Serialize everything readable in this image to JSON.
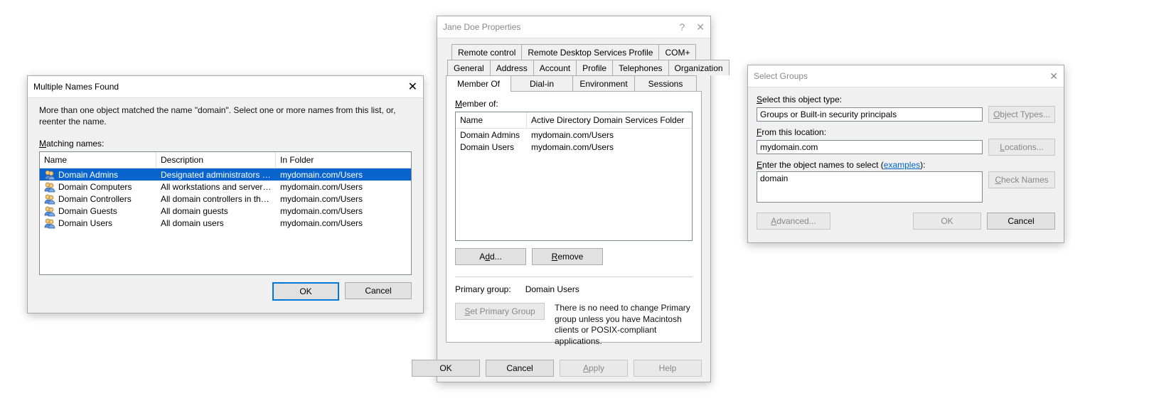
{
  "dlg1": {
    "title": "Multiple Names Found",
    "instruction": "More than one object matched the name \"domain\". Select one or more names from this list, or, reenter the name.",
    "matching_label": "Matching names:",
    "headers": {
      "name": "Name",
      "desc": "Description",
      "folder": "In Folder"
    },
    "rows": [
      {
        "name": "Domain Admins",
        "desc": "Designated administrators of th...",
        "folder": "mydomain.com/Users",
        "selected": true
      },
      {
        "name": "Domain Computers",
        "desc": "All workstations and servers joi...",
        "folder": "mydomain.com/Users"
      },
      {
        "name": "Domain Controllers",
        "desc": "All domain controllers in the do...",
        "folder": "mydomain.com/Users"
      },
      {
        "name": "Domain Guests",
        "desc": "All domain guests",
        "folder": "mydomain.com/Users"
      },
      {
        "name": "Domain Users",
        "desc": "All domain users",
        "folder": "mydomain.com/Users"
      }
    ],
    "ok": "OK",
    "cancel": "Cancel"
  },
  "dlg2": {
    "title": "Jane Doe Properties",
    "tabs": {
      "row1": [
        "Remote control",
        "Remote Desktop Services Profile",
        "COM+"
      ],
      "row2": [
        "General",
        "Address",
        "Account",
        "Profile",
        "Telephones",
        "Organization"
      ],
      "row3": [
        "Member Of",
        "Dial-in",
        "Environment",
        "Sessions"
      ]
    },
    "active_tab": "Member Of",
    "memberof_label": "Member of:",
    "mo_headers": {
      "name": "Name",
      "folder": "Active Directory Domain Services Folder"
    },
    "mo_rows": [
      {
        "name": "Domain Admins",
        "folder": "mydomain.com/Users"
      },
      {
        "name": "Domain Users",
        "folder": "mydomain.com/Users"
      }
    ],
    "add": "Add...",
    "remove": "Remove",
    "primary_label": "Primary group:",
    "primary_value": "Domain Users",
    "set_primary": "Set Primary Group",
    "note": "There is no need to change Primary group unless you have Macintosh clients or POSIX-compliant applications.",
    "ok": "OK",
    "cancel": "Cancel",
    "apply": "Apply",
    "help": "Help"
  },
  "dlg3": {
    "title": "Select Groups",
    "object_type_label": "Select this object type:",
    "object_type_value": "Groups or Built-in security principals",
    "object_types_btn": "Object Types...",
    "location_label": "From this location:",
    "location_value": "mydomain.com",
    "locations_btn": "Locations...",
    "enter_names_pre": "Enter the object names to select (",
    "enter_names_link": "examples",
    "enter_names_post": "):",
    "names_value": "domain",
    "check_names": "Check Names",
    "advanced": "Advanced...",
    "ok": "OK",
    "cancel": "Cancel"
  }
}
